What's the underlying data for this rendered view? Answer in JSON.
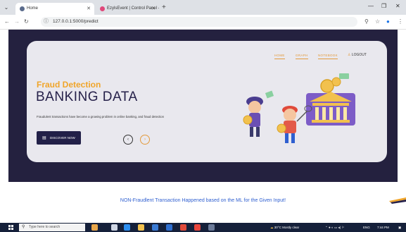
{
  "browser": {
    "tabs": [
      {
        "title": "Home",
        "active": true
      },
      {
        "title": "EzylsEvent | Control Panel - Lo",
        "active": false
      }
    ],
    "new_tab": "+",
    "url": "127.0.0.1:5000/predict"
  },
  "page": {
    "nav": [
      "HOME",
      "GRAPH",
      "NOTEBOOK"
    ],
    "logout": "LOGOUT",
    "eyebrow": "Fraud Detection",
    "headline": "BANKING DATA",
    "subtext": "Fraudulent transactions have become a growing problem in online banking, and fraud detection",
    "discover_label": "DISCOVER NOW",
    "result": "NON-Fraudlent Transaction Happened based on the ML for the Given Input!"
  },
  "taskbar": {
    "search_placeholder": "Type here to search",
    "weather": "30°C  Mostly clear",
    "lang": "ENG",
    "time": "7:44 PM"
  },
  "colors": {
    "accent": "#f0a52a",
    "hero_bg": "#24213f",
    "card_bg": "#e9e8ee",
    "button": "#222048",
    "result_text": "#2f5fd0"
  }
}
